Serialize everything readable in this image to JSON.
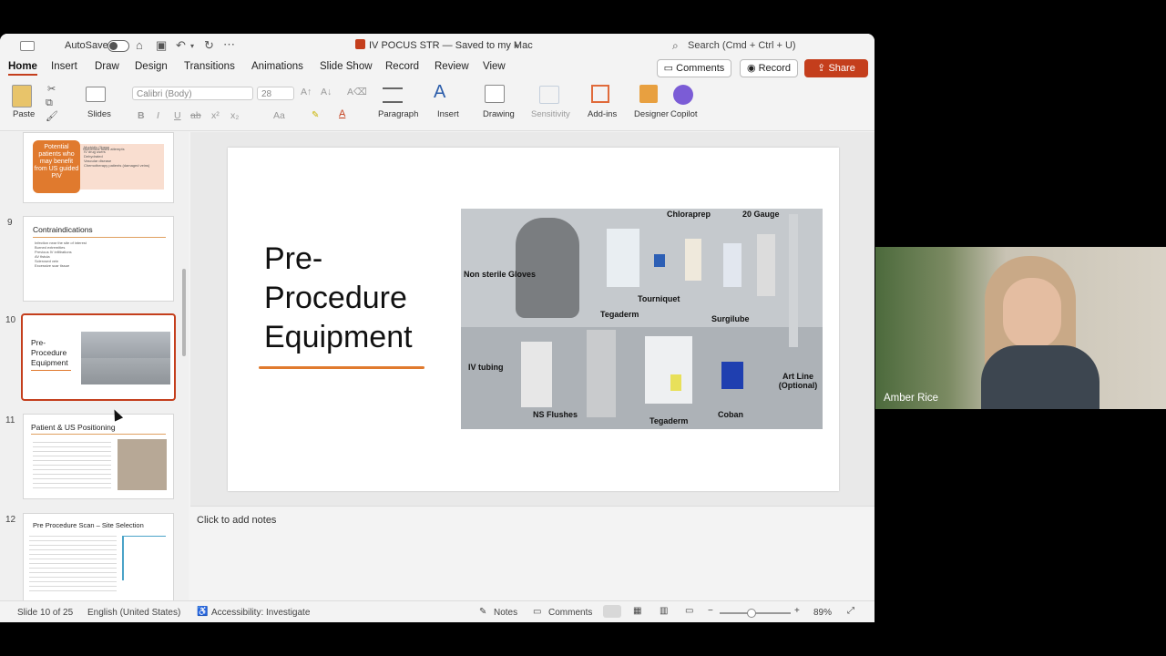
{
  "titlebar": {
    "autosave_label": "AutoSave",
    "doc_title": "IV POCUS  STR — Saved to my Mac",
    "search_placeholder": "Search (Cmd + Ctrl + U)"
  },
  "tabs": [
    "Home",
    "Insert",
    "Draw",
    "Design",
    "Transitions",
    "Animations",
    "Slide Show",
    "Record",
    "Review",
    "View"
  ],
  "actions": {
    "comments": "Comments",
    "record": "Record",
    "share": "Share"
  },
  "ribbon": {
    "paste": "Paste",
    "slides": "Slides",
    "font_name": "Calibri (Body)",
    "font_size": "28",
    "paragraph": "Paragraph",
    "insert": "Insert",
    "drawing": "Drawing",
    "sensitivity": "Sensitivity",
    "addins": "Add-ins",
    "designer": "Designer",
    "copilot": "Copilot",
    "format_buttons": [
      "B",
      "I",
      "U",
      "ab",
      "x²",
      "x₂",
      "Aa"
    ]
  },
  "thumbnails": {
    "slide8": {
      "box_text": "Potential patients who may benefit from US guided PIV",
      "bullets": [
        "Numerous failed attempts",
        "Morbidly Obese",
        "IV drug users",
        "Dehydrated",
        "Vascular disease",
        "Chemotherapy patients (damaged veins)"
      ]
    },
    "slide9": {
      "num": "9",
      "title": "Contraindications",
      "bullets": [
        "Infection near the site of interest",
        "Burned extremities",
        "Previous IV infiltrations",
        "AV fistula",
        "Sclerosed vein",
        "Excessive scar tissue"
      ]
    },
    "slide10": {
      "num": "10",
      "title": "Pre-Procedure Equipment"
    },
    "slide11": {
      "num": "11",
      "title": "Patient & US Positioning"
    },
    "slide12": {
      "num": "12",
      "title": "Pre Procedure Scan – Site Selection"
    }
  },
  "slide": {
    "title": "Pre-Procedure Equipment",
    "photo_labels": [
      "Chloraprep",
      "20 Gauge",
      "Non sterile Gloves",
      "Tourniquet",
      "Tegaderm",
      "Surgilube",
      "IV tubing",
      "NS Flushes",
      "Tegaderm",
      "Coban",
      "Art Line (Optional)"
    ]
  },
  "notes_placeholder": "Click to add notes",
  "status": {
    "slide_count": "Slide 10 of 25",
    "language": "English (United States)",
    "accessibility": "Accessibility: Investigate",
    "notes": "Notes",
    "comments": "Comments",
    "zoom": "89%"
  },
  "video": {
    "name": "Amber Rice"
  }
}
